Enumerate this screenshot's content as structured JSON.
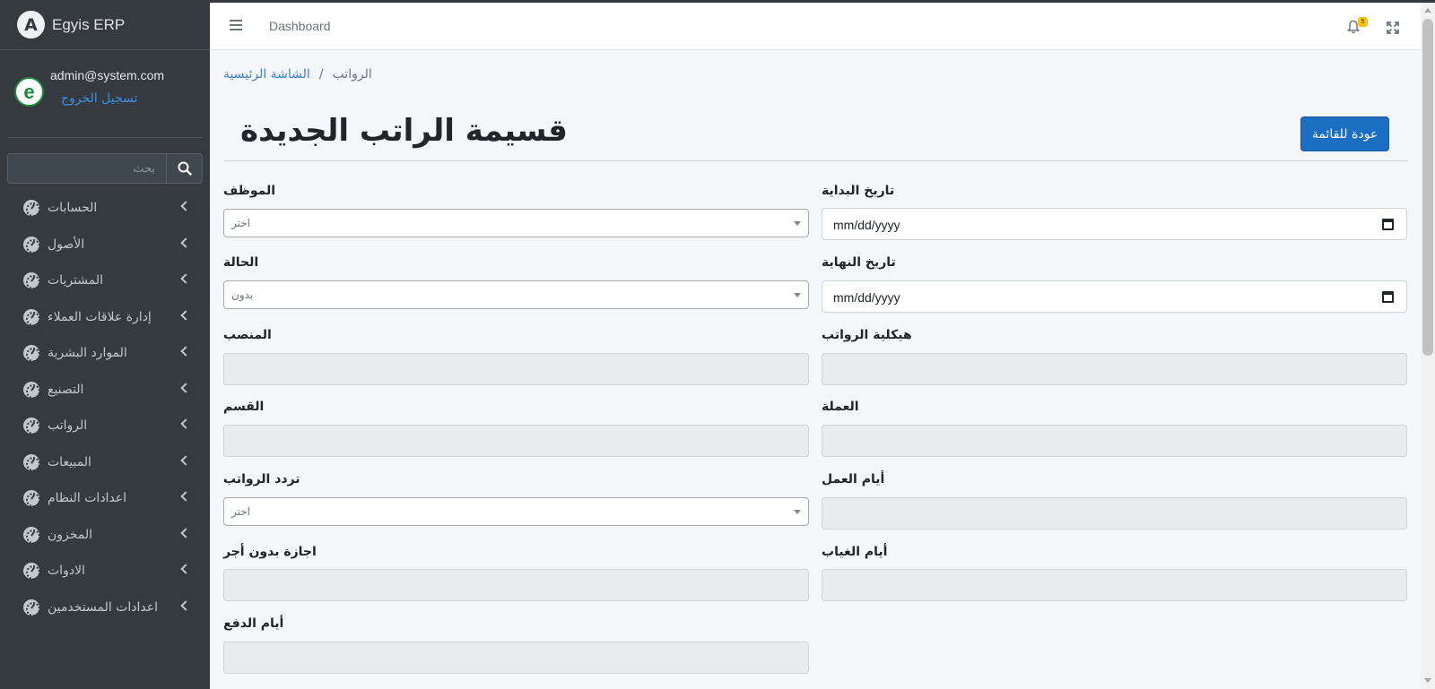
{
  "app": {
    "brand_logo": "A",
    "brand_name": "Egyis ERP"
  },
  "user": {
    "avatar_letter": "e",
    "email": "admin@system.com",
    "logout_label": "تسجيل الخروج"
  },
  "sidebar": {
    "search_placeholder": "بحث",
    "items": [
      {
        "label": "الحسابات"
      },
      {
        "label": "الأصول"
      },
      {
        "label": "المشتريات"
      },
      {
        "label": "إدارة علاقات العملاء"
      },
      {
        "label": "الموارد البشرية"
      },
      {
        "label": "التصنيع"
      },
      {
        "label": "الرواتب"
      },
      {
        "label": "المبيعات"
      },
      {
        "label": "اعدادات النظام"
      },
      {
        "label": "المخزون"
      },
      {
        "label": "الادوات"
      },
      {
        "label": "اعدادات المستخدمين"
      }
    ]
  },
  "header": {
    "nav_label": "Dashboard",
    "notification_count": "5"
  },
  "breadcrumb": {
    "home": "الشاشة الرئيسية",
    "separator": "/",
    "current": "الرواتب"
  },
  "page": {
    "title": "قسيمة الراتب الجديدة",
    "back_button": "عودة للقائمة"
  },
  "form": {
    "start_date": {
      "label": "تاريخ البداية",
      "value": "mm/dd/yyyy"
    },
    "employee": {
      "label": "الموظف",
      "value": "اختر"
    },
    "end_date": {
      "label": "تاريخ النهاية",
      "value": "mm/dd/yyyy"
    },
    "status": {
      "label": "الحالة",
      "value": "بدون"
    },
    "salary_structure": {
      "label": "هيكلية الرواتب"
    },
    "position": {
      "label": "المنصب"
    },
    "currency": {
      "label": "العملة"
    },
    "department": {
      "label": "القسم"
    },
    "working_days": {
      "label": "أيام العمل"
    },
    "payroll_frequency": {
      "label": "تردد الرواتب",
      "value": "اختر"
    },
    "absent_days": {
      "label": "أيام الغياب"
    },
    "unpaid_leave": {
      "label": "اجازة بدون أجر"
    },
    "payment_days": {
      "label": "أيام الدفع"
    }
  }
}
